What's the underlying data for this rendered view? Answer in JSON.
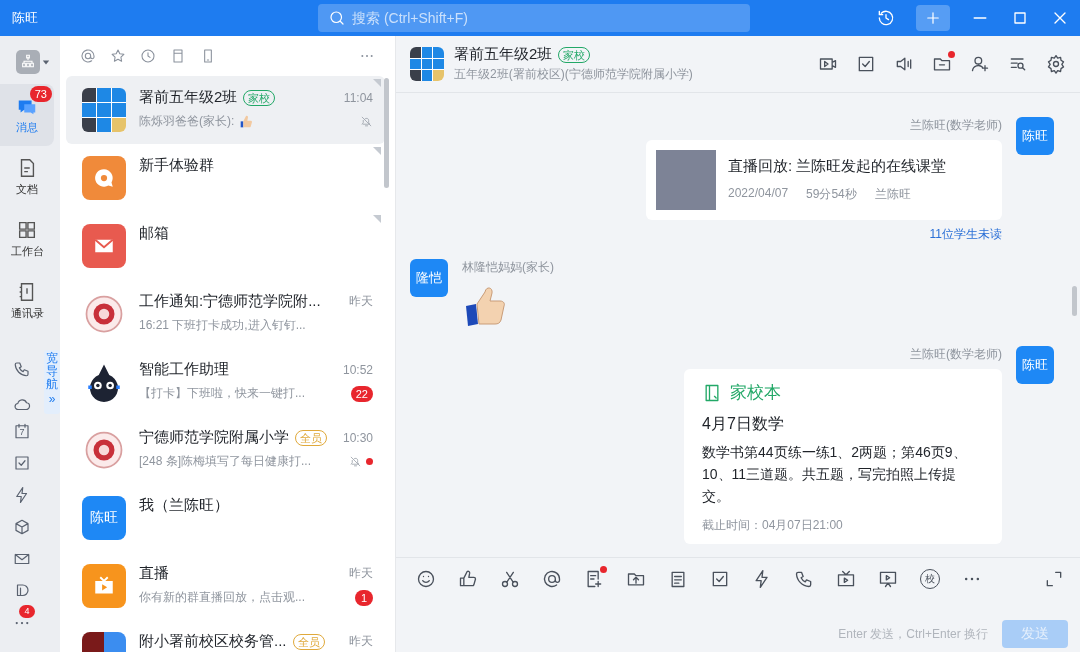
{
  "window": {
    "user": "陈旺",
    "search": {
      "placeholder": "搜索 (Ctrl+Shift+F)"
    }
  },
  "rail": {
    "items": [
      {
        "label": "消息",
        "selected": true,
        "badge": "73"
      },
      {
        "label": "文档",
        "selected": false
      },
      {
        "label": "工作台",
        "selected": false
      },
      {
        "label": "通讯录",
        "selected": false
      }
    ],
    "wide_nav": {
      "label": "宽导航",
      "arrow": "»"
    },
    "calendar_day": "7",
    "more_badge": "4"
  },
  "conversations": [
    {
      "kind": "grid",
      "name": "署前五年级2班",
      "tag": {
        "text": "家校",
        "color": "#22a867"
      },
      "time": "11:04",
      "preview": "陈烁羽爸爸(家长):",
      "sticker": true,
      "muted": true,
      "dot": false,
      "pinned": true,
      "selected": true
    },
    {
      "kind": "chat",
      "name": "新手体验群",
      "muted": false,
      "dot": false,
      "sticker": false,
      "pinned": true,
      "selected": false
    },
    {
      "kind": "mail",
      "name": "邮箱",
      "muted": false,
      "dot": false,
      "sticker": false,
      "pinned": true,
      "selected": false
    },
    {
      "kind": "seal",
      "name": "工作通知:宁德师范学院附...",
      "time": "昨天",
      "preview": "16:21 下班打卡成功,进入钉钉...",
      "muted": false,
      "dot": false,
      "sticker": false,
      "pinned": false,
      "selected": false
    },
    {
      "kind": "robot",
      "name": "智能工作助理",
      "time": "10:52",
      "preview": "【打卡】下班啦，快来一键打...",
      "badge": "22",
      "muted": false,
      "dot": false,
      "sticker": false,
      "pinned": false,
      "selected": false
    },
    {
      "kind": "seal",
      "name": "宁德师范学院附属小学",
      "tag": {
        "text": "全员",
        "color": "#e0a93b"
      },
      "time": "10:30",
      "preview": "[248 条]陈梅填写了每日健康打...",
      "muted": true,
      "dot": true,
      "sticker": false,
      "pinned": false,
      "selected": false
    },
    {
      "kind": "text",
      "avatar_text": "陈旺",
      "name": "我（兰陈旺）",
      "muted": false,
      "dot": false,
      "sticker": false,
      "pinned": false,
      "selected": false
    },
    {
      "kind": "tv",
      "name": "直播",
      "time": "昨天",
      "preview": "你有新的群直播回放，点击观...",
      "badge": "1",
      "muted": false,
      "dot": false,
      "sticker": false,
      "pinned": false,
      "selected": false
    },
    {
      "kind": "split",
      "name": "附小署前校区校务管...",
      "tag": {
        "text": "全员",
        "color": "#e0a93b"
      },
      "time": "昨天",
      "muted": false,
      "dot": false,
      "sticker": false,
      "pinned": false,
      "selected": false
    }
  ],
  "chat": {
    "title": "署前五年级2班",
    "tag": {
      "text": "家校",
      "color": "#22a867"
    },
    "subtitle": "五年级2班(署前校区)(宁德师范学院附属小学)",
    "files_dot": true,
    "messages": [
      {
        "kind": "live_replay",
        "outgoing": true,
        "sender": "兰陈旺(数学老师)",
        "avatar": "陈旺",
        "title": "直播回放: 兰陈旺发起的在线课堂",
        "date": "2022/04/07",
        "duration": "59分54秒",
        "host": "兰陈旺",
        "read_status": "11位学生未读"
      },
      {
        "kind": "sticker",
        "outgoing": false,
        "sender": "林隆恺妈妈(家长)",
        "avatar": "隆恺"
      },
      {
        "kind": "homework",
        "outgoing": true,
        "sender": "兰陈旺(数学老师)",
        "avatar": "陈旺",
        "app": "家校本",
        "title": "4月7日数学",
        "body": "数学书第44页练一练1、2两题；第46页9、10、11三道题。共五题，写完拍照上传提交。",
        "deadline": "截止时间：04月07日21:00"
      }
    ]
  },
  "composer": {
    "note_dot": true,
    "school_label": "校",
    "hint": "Enter 发送，Ctrl+Enter 换行",
    "send": "发送",
    "send_disabled": true
  }
}
